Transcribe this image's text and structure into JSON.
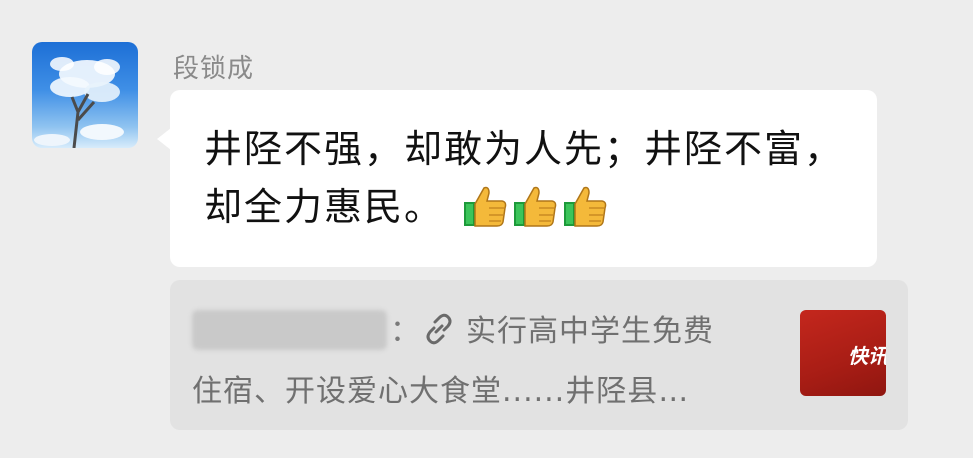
{
  "message": {
    "sender_name": "段锁成",
    "text": "井陉不强，却敢为人先；井陉不富，却全力惠民。",
    "emoji": [
      "thumbs-up",
      "thumbs-up",
      "thumbs-up"
    ]
  },
  "quote": {
    "author_blurred": "██████████",
    "colon": "：",
    "line1": "实行高中学生免费",
    "line2": "住宿、开设爱心大食堂......井陉县…",
    "thumbnail_text": "快讯"
  }
}
